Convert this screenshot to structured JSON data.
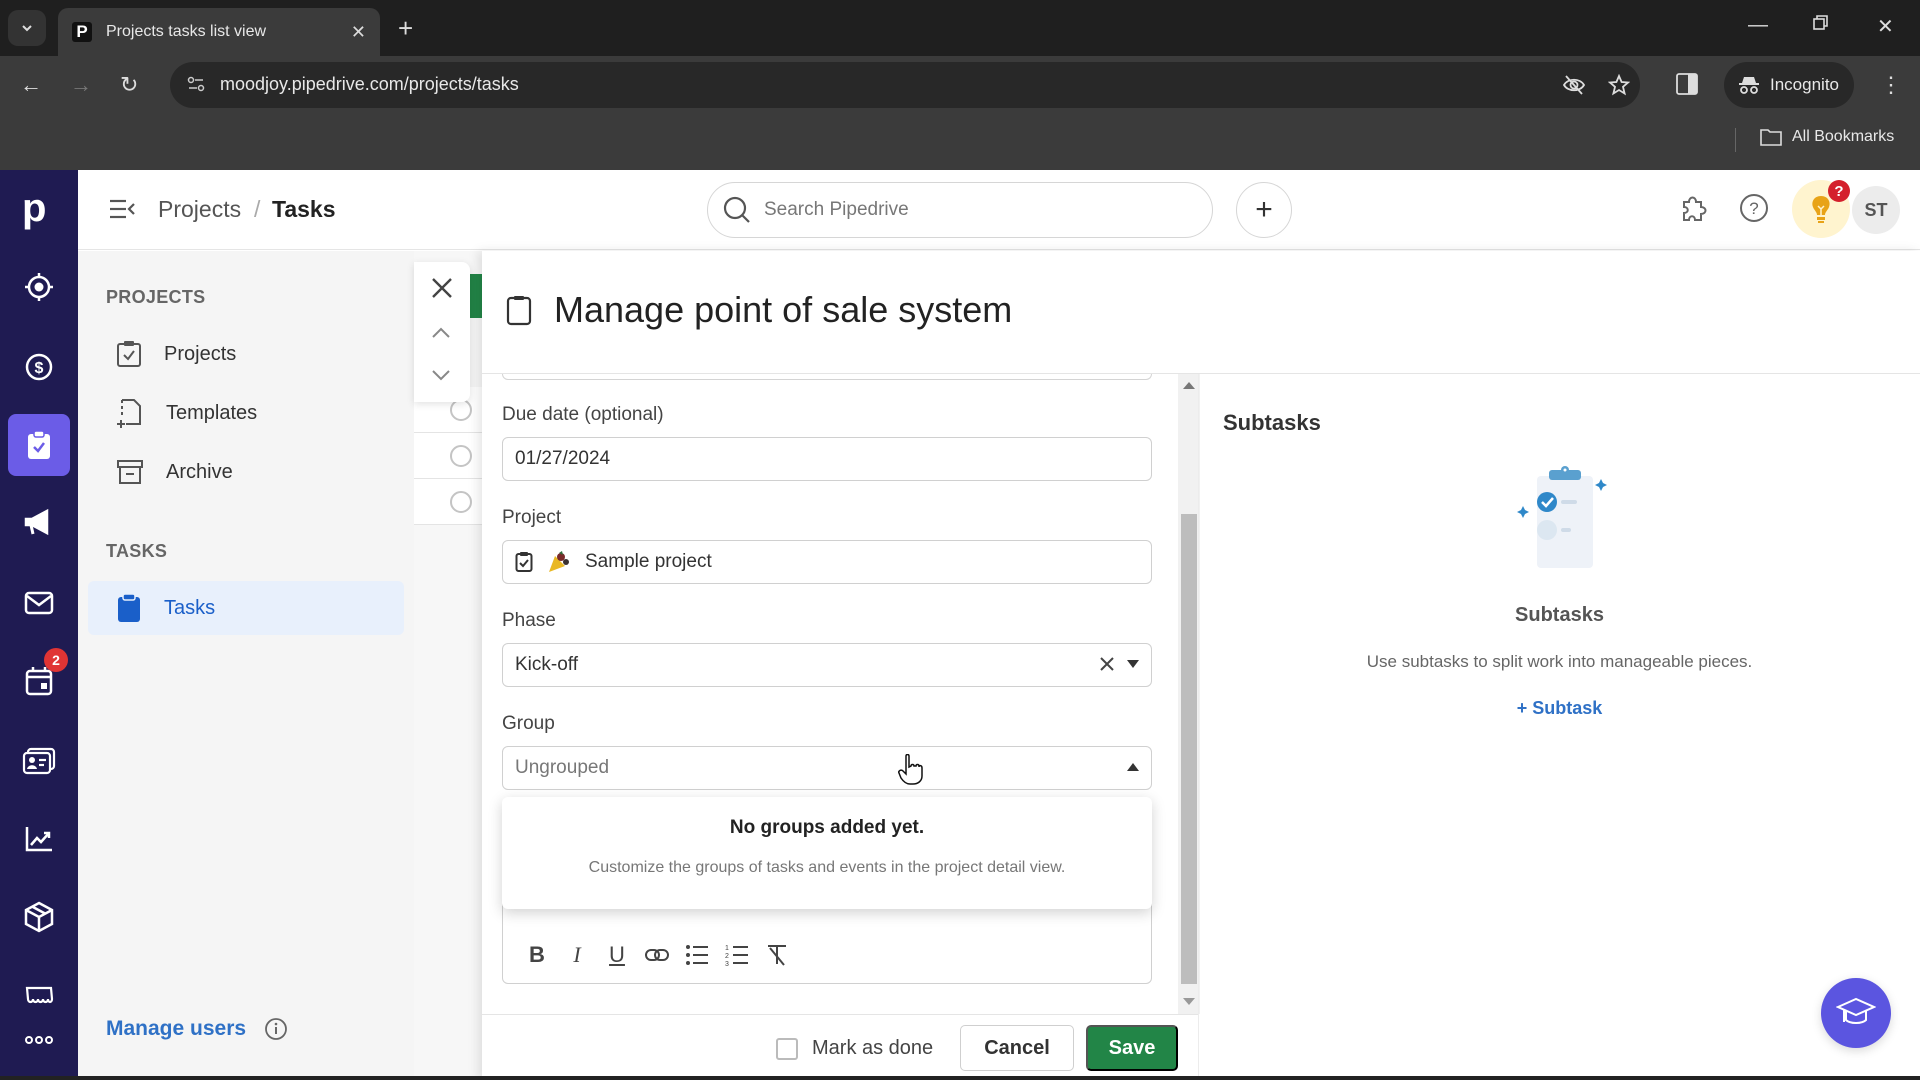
{
  "browser": {
    "tab_title": "Projects tasks list view",
    "favicon_letter": "P",
    "url": "moodjoy.pipedrive.com/projects/tasks",
    "profile_label": "Incognito",
    "bookmarks_label": "All Bookmarks"
  },
  "app": {
    "logo_letter": "p",
    "nav_rail": [
      {
        "name": "leads",
        "icon": "target-icon"
      },
      {
        "name": "deals",
        "icon": "dollar-icon"
      },
      {
        "name": "projects",
        "icon": "clipboard-check-icon",
        "active": true
      },
      {
        "name": "campaigns",
        "icon": "megaphone-icon"
      },
      {
        "name": "mail",
        "icon": "mail-icon"
      },
      {
        "name": "activities",
        "icon": "calendar-icon",
        "badge": "2"
      },
      {
        "name": "contacts",
        "icon": "contact-card-icon"
      },
      {
        "name": "insights",
        "icon": "chart-icon"
      },
      {
        "name": "products",
        "icon": "box-icon"
      },
      {
        "name": "marketplace",
        "icon": "store-icon"
      },
      {
        "name": "more",
        "icon": "more-icon"
      }
    ]
  },
  "header": {
    "breadcrumb": [
      "Projects",
      "Tasks"
    ],
    "breadcrumb_sep": "/",
    "search_placeholder": "Search Pipedrive",
    "add_label": "+",
    "tips_badge": "?",
    "avatar_initials": "ST"
  },
  "sidebar": {
    "projects_heading": "PROJECTS",
    "projects_items": [
      {
        "label": "Projects",
        "icon": "clipboard-check-icon"
      },
      {
        "label": "Templates",
        "icon": "template-icon"
      },
      {
        "label": "Archive",
        "icon": "archive-icon"
      }
    ],
    "tasks_heading": "TASKS",
    "tasks_items": [
      {
        "label": "Tasks",
        "icon": "clipboard-icon",
        "active": true
      }
    ],
    "manage_users": "Manage users"
  },
  "task": {
    "title": "Manage point of sale system",
    "fields": {
      "due_date_label": "Due date (optional)",
      "due_date_value": "01/27/2024",
      "project_label": "Project",
      "project_value": "Sample project",
      "phase_label": "Phase",
      "phase_value": "Kick-off",
      "group_label": "Group",
      "group_placeholder": "Ungrouped"
    },
    "group_dropdown": {
      "title": "No groups added yet.",
      "text": "Customize the groups of tasks and events in the project detail view."
    },
    "editor_toolbar": [
      "bold",
      "italic",
      "underline",
      "link",
      "bulleted-list",
      "numbered-list",
      "clear-format"
    ],
    "footer": {
      "mark_done_label": "Mark as done",
      "mark_done_checked": false,
      "cancel_label": "Cancel",
      "save_label": "Save"
    }
  },
  "subtasks": {
    "heading": "Subtasks",
    "empty_title": "Subtasks",
    "empty_text": "Use subtasks to split work into manageable pieces.",
    "add_label": "+ Subtask"
  },
  "colors": {
    "rail_bg": "#1f1b52",
    "rail_active": "#6b5ce7",
    "save_green": "#228547",
    "link_blue": "#2f71c6",
    "badge_red": "#e03434"
  }
}
